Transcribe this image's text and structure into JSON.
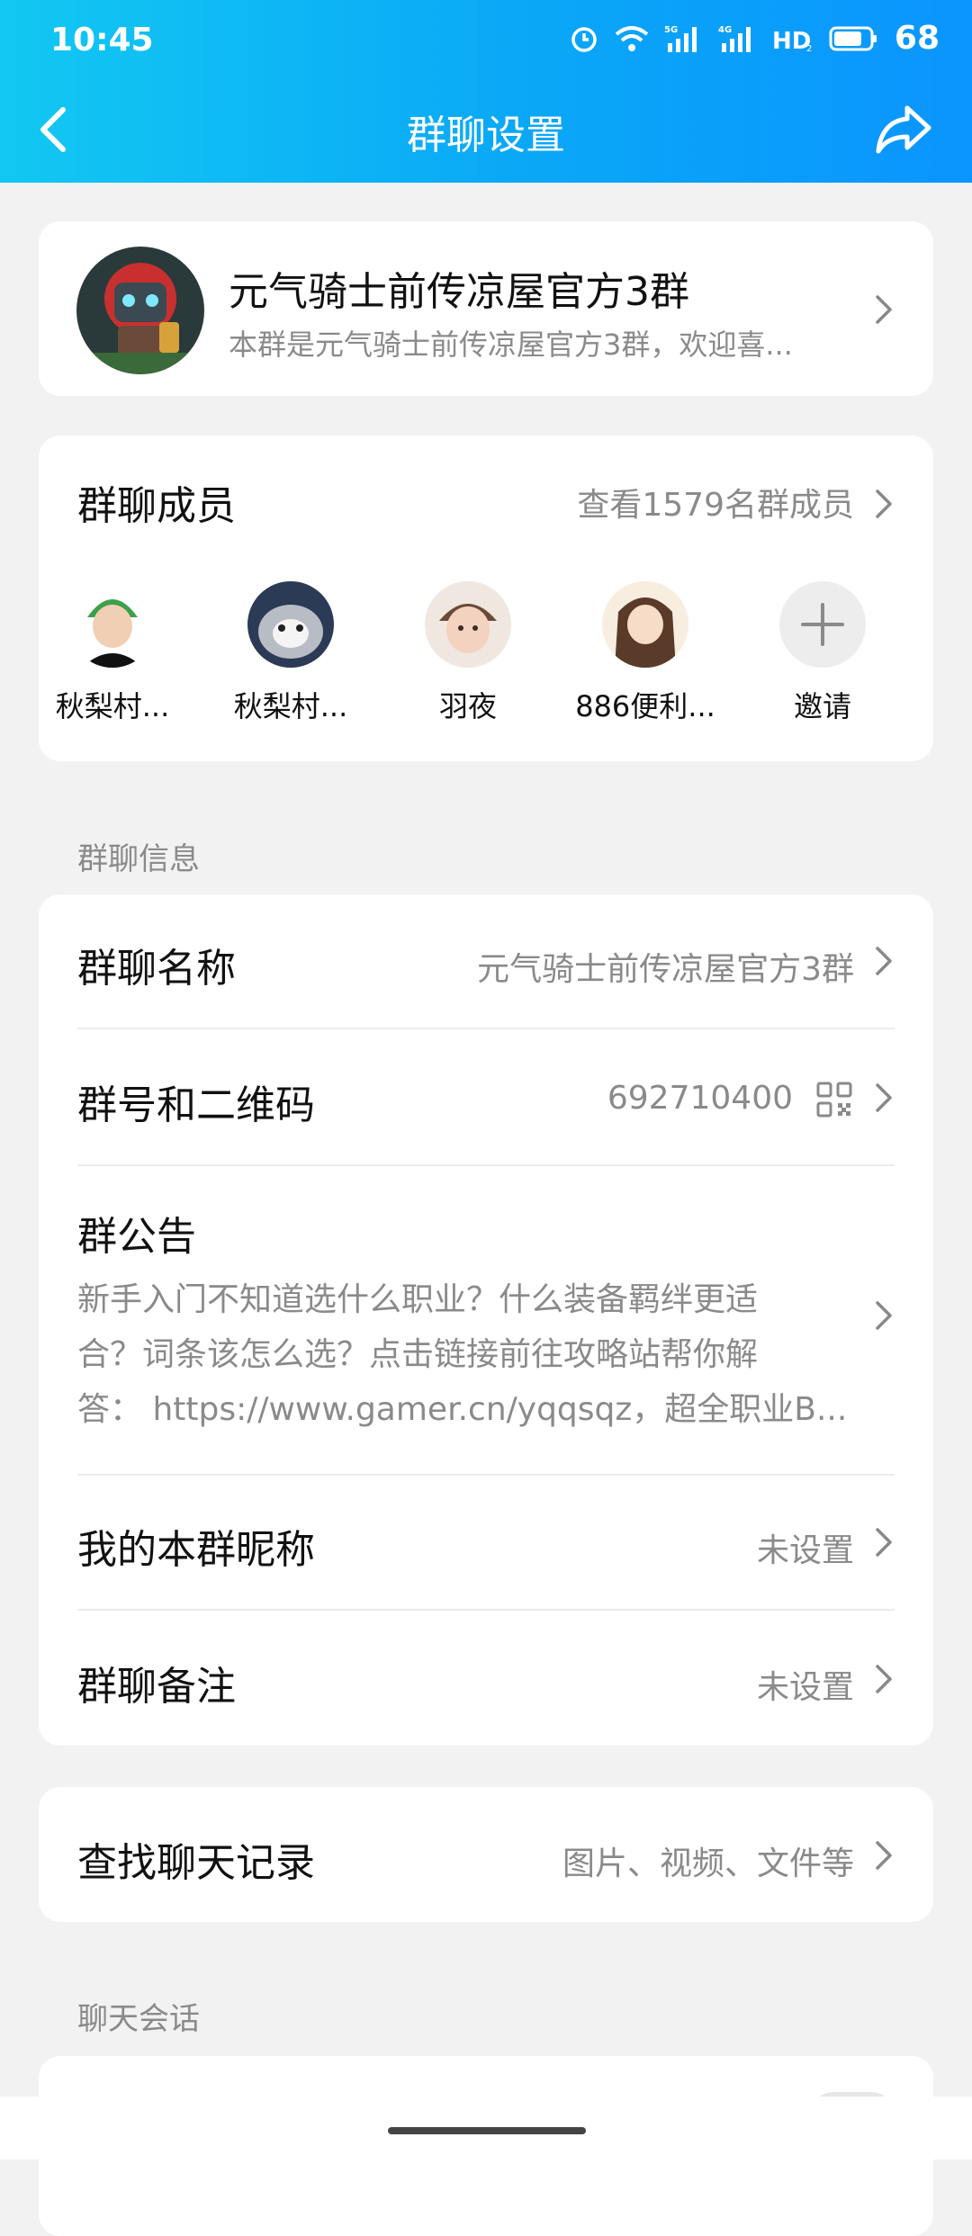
{
  "status": {
    "time": "10:45",
    "battery": "68",
    "icons": [
      "alarm-icon",
      "wifi-icon",
      "signal-5g-icon",
      "signal-4g-icon",
      "hd-icon",
      "battery-icon"
    ]
  },
  "nav": {
    "title": "群聊设置",
    "back_icon": "chevron-left-icon",
    "share_icon": "share-icon"
  },
  "group": {
    "name": "元气骑士前传凉屋官方3群",
    "desc": "本群是元气骑士前传凉屋官方3群，欢迎喜..."
  },
  "members": {
    "title": "群聊成员",
    "link": "查看1579名群成员",
    "list": [
      {
        "name": "秋梨村..."
      },
      {
        "name": "秋梨村..."
      },
      {
        "name": "羽夜"
      },
      {
        "name": "886便利..."
      },
      {
        "name": "邀请"
      }
    ]
  },
  "sections": {
    "info": "群聊信息",
    "chat": "聊天会话"
  },
  "info": {
    "name_label": "群聊名称",
    "name_value": "元气骑士前传凉屋官方3群",
    "number_label": "群号和二维码",
    "number_value": "692710400",
    "notice_label": "群公告",
    "notice_lines": [
      "新手入门不知道选什么职业？什么装备羁绊更适",
      "合？词条该怎么选？点击链接前往攻略站帮你解",
      "答： https://www.gamer.cn/yqqsqz，超全职业B..."
    ],
    "nickname_label": "我的本群昵称",
    "nickname_value": "未设置",
    "remark_label": "群聊备注",
    "remark_value": "未设置"
  },
  "search": {
    "label": "查找聊天记录",
    "value": "图片、视频、文件等"
  },
  "colors": {
    "header_start": "#12c8f2",
    "header_end": "#0b95ff",
    "background": "#f2f2f2",
    "secondary_text": "#8a8a8a"
  }
}
